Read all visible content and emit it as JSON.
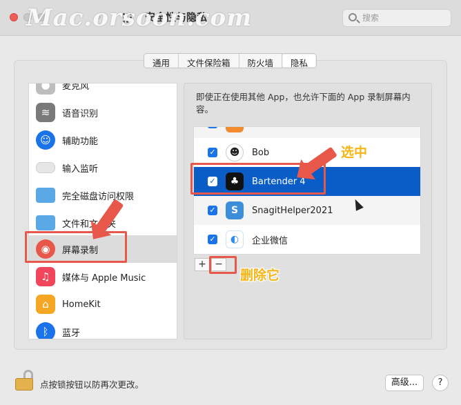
{
  "window": {
    "title": "安全性与隐私",
    "watermark": "Mac.orsoon.com"
  },
  "search": {
    "placeholder": "搜索"
  },
  "tabs": [
    {
      "label": "通用"
    },
    {
      "label": "文件保险箱"
    },
    {
      "label": "防火墙"
    },
    {
      "label": "隐私",
      "active": true
    }
  ],
  "sidebar": {
    "items": [
      {
        "label": "麦克风",
        "icon": "microphone-icon"
      },
      {
        "label": "语音识别",
        "icon": "waveform-icon"
      },
      {
        "label": "辅助功能",
        "icon": "accessibility-icon"
      },
      {
        "label": "输入监听",
        "icon": "keyboard-icon"
      },
      {
        "label": "完全磁盘访问权限",
        "icon": "folder-icon"
      },
      {
        "label": "文件和文件夹",
        "icon": "folder-icon"
      },
      {
        "label": "屏幕录制",
        "icon": "screen-record-icon",
        "selected": true
      },
      {
        "label": "媒体与 Apple Music",
        "icon": "music-icon"
      },
      {
        "label": "HomeKit",
        "icon": "home-icon"
      },
      {
        "label": "蓝牙",
        "icon": "bluetooth-icon"
      }
    ]
  },
  "pane": {
    "description": "即使正在使用其他 App，也允许下面的 App 录制屏幕内容。",
    "apps": [
      {
        "label": "",
        "checked": true,
        "icon": "app-icon"
      },
      {
        "label": "Bob",
        "checked": true,
        "icon": "bob-icon"
      },
      {
        "label": "Bartender 4",
        "checked": true,
        "icon": "bartender-icon",
        "selected": true
      },
      {
        "label": "SnagitHelper2021",
        "checked": true,
        "icon": "snagit-icon"
      },
      {
        "label": "企业微信",
        "checked": true,
        "icon": "wecom-icon"
      }
    ],
    "add_label": "+",
    "remove_label": "−"
  },
  "annotations": {
    "selected_note": "选中",
    "remove_note": "删除它",
    "color": "#e8584a",
    "text_color": "#f7b515"
  },
  "footer": {
    "lock_text": "点按锁按钮以防再次更改。",
    "advanced_label": "高级...",
    "help_label": "?"
  },
  "colors": {
    "selection_blue": "#0a5dc7",
    "checkbox_blue": "#1a73e8",
    "close_red": "#ec5e57"
  }
}
